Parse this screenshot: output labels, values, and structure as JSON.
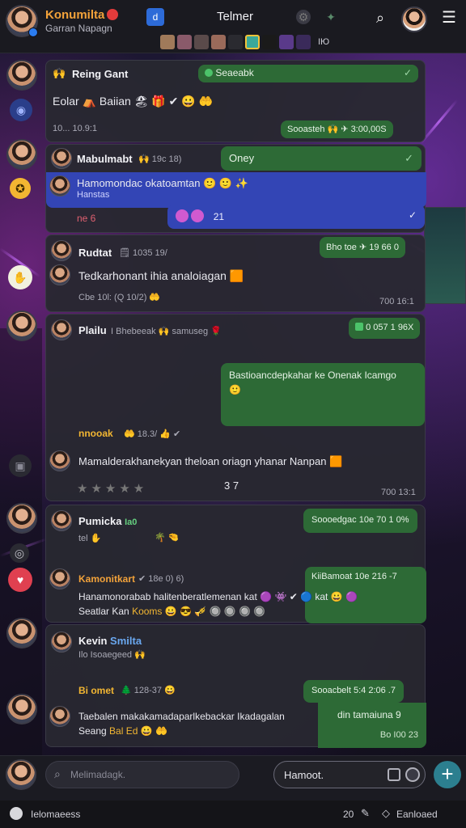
{
  "header": {
    "app_name": "Konumilta",
    "app_sub": "Garran Napagn",
    "title": "Telmer",
    "story_count": "IЮ",
    "icons": [
      "discord-icon",
      "settings-icon",
      "pin-icon",
      "search-icon",
      "menu-icon"
    ]
  },
  "messages": {
    "m1": {
      "name": "Reing Gant",
      "green_tag": "Seaeabk",
      "text": "Eolar ⛺ Baiian 🏖 🎁 ✔ 😀 🤲",
      "time": "10... 10.9:1",
      "green_meta": "Sooasteh 🙌 ✈ 3:00,00S"
    },
    "m2": {
      "name": "Mabulmabt",
      "name_tag": "🙌 19c 18)",
      "green_text": "Oney",
      "text": "Hamomondac okatoamtan 🙂 🙂 ✨",
      "text2": "Hanstas",
      "tag": "ne 6",
      "blue_count": "21"
    },
    "m3": {
      "name": "Rudtat",
      "name_meta": "🗒 1035 19/",
      "green_meta": "Bho toe ✈ 19 66 0",
      "text": "Tedkarhonant ihia analoiagan 🟧",
      "sub_meta": "Cbe 10l: (Q 10/2) 🤲",
      "time": "700 16:1"
    },
    "m4": {
      "name": "Plailu",
      "name_tag": "I Bhebeeak 🙌 samuseg 🌹",
      "green_meta": "0 057 1 96X",
      "bubble_text": "Bastioancdepkahar ke Onenak Icamgo",
      "bubble_emoji": "🙂",
      "line2_name": "nnooak",
      "line2_meta": "🤲 18.3/ 👍 ✔",
      "text": "Mamalderakhanekyan theloan oriagn yhanar Nanpan 🟧",
      "rating": "3 7",
      "time": "700 13:1"
    },
    "m5": {
      "name": "Pumicka",
      "name_tag": "Ia0",
      "sub": "tel ✋",
      "emoji_line": "🌴 🤏",
      "green_meta": "Soooedgac 10e 70 1 0%",
      "name2": "Kamonitkart",
      "name2_meta": "✔ 18e 0) 6)",
      "green_meta2": "KiiBamoat 10e 216 -7",
      "text": "Hanamonorabab halitenberatlemenan kat",
      "text_emoji": "🟣 👾 ✔ 🔵 kat 😀 🟣",
      "text2": "Seatlar Kan",
      "text2_tag": "Kooms",
      "text2_emoji": "😀 😎 🎺 🔘 🔘 🔘 🔘"
    },
    "m6": {
      "name": "Kevin",
      "name_tag": "Smilta",
      "sub": "Ilo Isoaegeed",
      "sub_emoji": "🙌",
      "line2_name": "Bi omet",
      "line2_meta": "🌲 128-37 😀",
      "green_meta": "Sooacbelt 5:4 2:06 .7",
      "text": "Taebalen makakamadaparlkebackar Ikadagalan",
      "text2": "Seang",
      "text2_tag": "Bal Ed",
      "text2_emoji": "😀 🤲",
      "green_text": "din tamaiuna 9",
      "time": "Bo I00 23"
    }
  },
  "composer": {
    "search_placeholder": "Melimadagk.",
    "field_value": "Hamoot."
  },
  "footer": {
    "left_label": "Ielomaeess",
    "right_label": "Eanloaed",
    "count": "20"
  },
  "colors": {
    "accent": "#f2a23a",
    "green_bubble": "#2d6a36",
    "blue_bubble": "#3345b5",
    "plus": "#2c7f8f"
  }
}
